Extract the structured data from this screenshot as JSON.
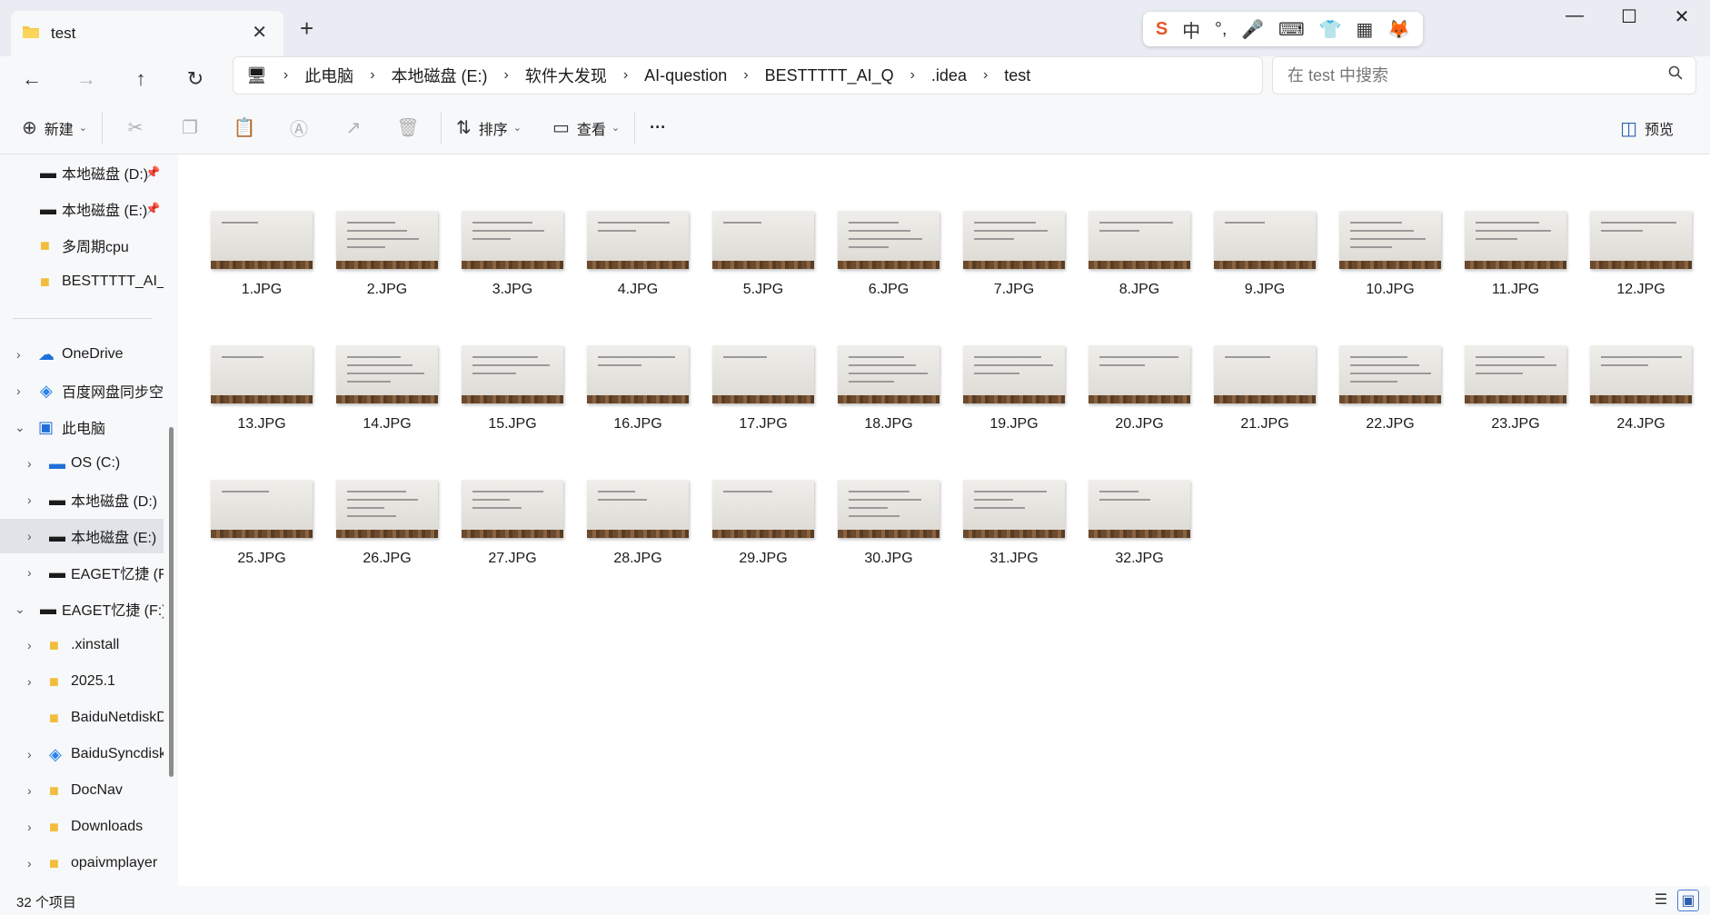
{
  "window": {
    "tab_title": "test",
    "tab_close_glyph": "✕",
    "new_tab_glyph": "+",
    "minimize_glyph": "—",
    "maximize_glyph": "☐",
    "close_glyph": "✕"
  },
  "ime": {
    "items": [
      "S",
      "中",
      "°,",
      "🎤",
      "⌨",
      "👕",
      "▦",
      "🦊"
    ]
  },
  "nav": {
    "back": "←",
    "forward": "→",
    "up": "↑",
    "refresh": "↻",
    "breadcrumbs": [
      "此电脑",
      "本地磁盘 (E:)",
      "软件大发现",
      "AI-question",
      "BESTTTTT_AI_Q",
      ".idea",
      "test"
    ],
    "separator": "›",
    "pc_icon": "🖥"
  },
  "search": {
    "placeholder": "在 test 中搜索",
    "icon": "search-icon"
  },
  "toolbar": {
    "new_label": "新建",
    "sort_label": "排序",
    "view_label": "查看",
    "more_label": "···",
    "preview_label": "预览"
  },
  "sidebar": {
    "items": [
      {
        "label": "本地磁盘 (D:)",
        "icon": "drive",
        "pinned": true
      },
      {
        "label": "本地磁盘 (E:)",
        "icon": "drive",
        "pinned": true
      },
      {
        "label": "多周期cpu",
        "icon": "folder"
      },
      {
        "label": "BESTTTTT_AI_Q",
        "icon": "folder"
      },
      {
        "label": "OneDrive",
        "icon": "cloud"
      },
      {
        "label": "百度网盘同步空间",
        "icon": "sync"
      },
      {
        "label": "此电脑",
        "icon": "pc",
        "expanded": true
      },
      {
        "label": "OS (C:)",
        "icon": "windows-drive"
      },
      {
        "label": "本地磁盘 (D:)",
        "icon": "drive"
      },
      {
        "label": "本地磁盘 (E:)",
        "icon": "drive",
        "selected": true
      },
      {
        "label": "EAGET忆捷 (F:)",
        "icon": "drive"
      },
      {
        "label": "EAGET忆捷 (F:)",
        "icon": "drive",
        "expanded": true
      },
      {
        "label": ".xinstall",
        "icon": "folder"
      },
      {
        "label": "2025.1",
        "icon": "folder"
      },
      {
        "label": "BaiduNetdiskDownload",
        "icon": "folder"
      },
      {
        "label": "BaiduSyncdisk",
        "icon": "sync"
      },
      {
        "label": "DocNav",
        "icon": "folder"
      },
      {
        "label": "Downloads",
        "icon": "folder"
      },
      {
        "label": "opaivmplayer",
        "icon": "folder"
      }
    ]
  },
  "files": [
    "1.JPG",
    "2.JPG",
    "3.JPG",
    "4.JPG",
    "5.JPG",
    "6.JPG",
    "7.JPG",
    "8.JPG",
    "9.JPG",
    "10.JPG",
    "11.JPG",
    "12.JPG",
    "13.JPG",
    "14.JPG",
    "15.JPG",
    "16.JPG",
    "17.JPG",
    "18.JPG",
    "19.JPG",
    "20.JPG",
    "21.JPG",
    "22.JPG",
    "23.JPG",
    "24.JPG",
    "25.JPG",
    "26.JPG",
    "27.JPG",
    "28.JPG",
    "29.JPG",
    "30.JPG",
    "31.JPG",
    "32.JPG"
  ],
  "status": {
    "item_count": "32 个项目"
  }
}
